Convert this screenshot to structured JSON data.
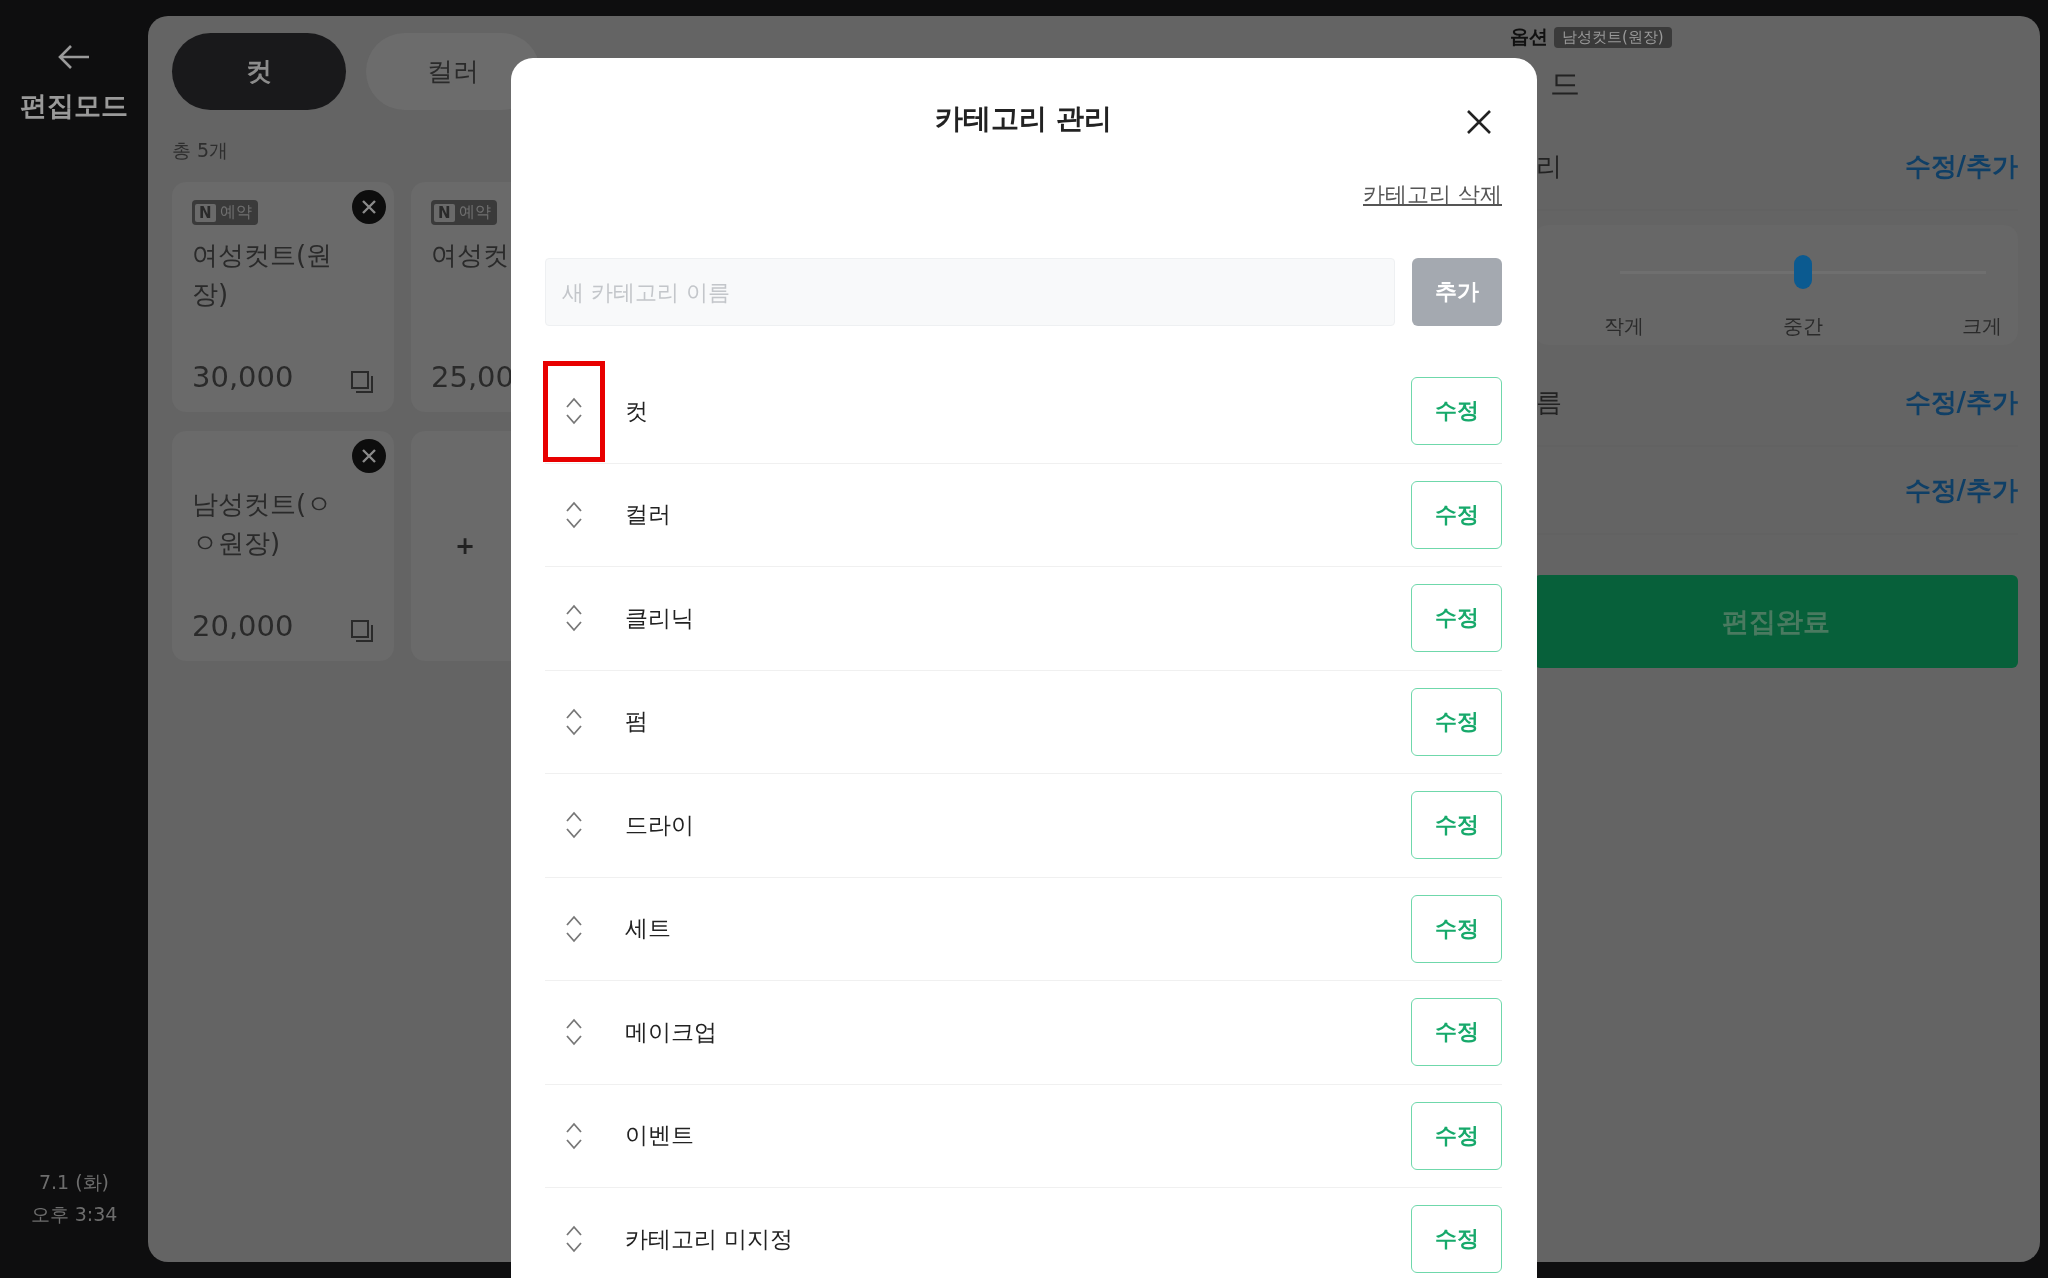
{
  "sidebar": {
    "title": "편집모드",
    "date": "7.1 (화)",
    "time": "오후 3:34"
  },
  "category_tabs": [
    {
      "label": "컷",
      "selected": true
    },
    {
      "label": "컬러",
      "selected": false
    }
  ],
  "total_count": "총 5개",
  "services": [
    {
      "kind": "service",
      "badge_logo": "N",
      "badge": "예약",
      "title": "여성컷트(원장)",
      "price": "30,000",
      "removable": true,
      "copyable": true
    },
    {
      "kind": "service",
      "badge_logo": "N",
      "badge": "예약",
      "title": "여성컷",
      "price": "25,00",
      "removable": false,
      "copyable": false
    },
    {
      "kind": "service",
      "title": "남성컷트(ㅇㅇ원장)",
      "price": "20,000",
      "removable": true,
      "copyable": true
    },
    {
      "kind": "add",
      "label": "+"
    }
  ],
  "option_panel": {
    "label": "옵션",
    "badge": "남성컷트(원장)",
    "heading": "드",
    "rows": [
      {
        "kind": "link",
        "label": "리",
        "action": "수정/추가"
      },
      {
        "kind": "slider",
        "level": 0.5,
        "labels": [
          "작게",
          "중간",
          "크게"
        ]
      },
      {
        "kind": "link",
        "label": "름",
        "action": "수정/추가"
      },
      {
        "kind": "link",
        "action": "수정/추가"
      }
    ],
    "done_button": "편집완료"
  },
  "modal": {
    "title": "카테고리 관리",
    "delete_link": "카테고리 삭제",
    "new_category": {
      "placeholder": "새 카테고리 이름"
    },
    "add_button": {
      "label": "추가",
      "disabled": true
    },
    "categories": [
      {
        "name": "컷",
        "edit": "수정",
        "highlighted": true
      },
      {
        "name": "컬러",
        "edit": "수정",
        "highlighted": false
      },
      {
        "name": "클리닉",
        "edit": "수정",
        "highlighted": false
      },
      {
        "name": "펌",
        "edit": "수정",
        "highlighted": false
      },
      {
        "name": "드라이",
        "edit": "수정",
        "highlighted": false
      },
      {
        "name": "세트",
        "edit": "수정",
        "highlighted": false
      },
      {
        "name": "메이크업",
        "edit": "수정",
        "highlighted": false
      },
      {
        "name": "이벤트",
        "edit": "수정",
        "highlighted": false
      },
      {
        "name": "카테고리 미지정",
        "edit": "수정",
        "highlighted": false
      }
    ]
  }
}
